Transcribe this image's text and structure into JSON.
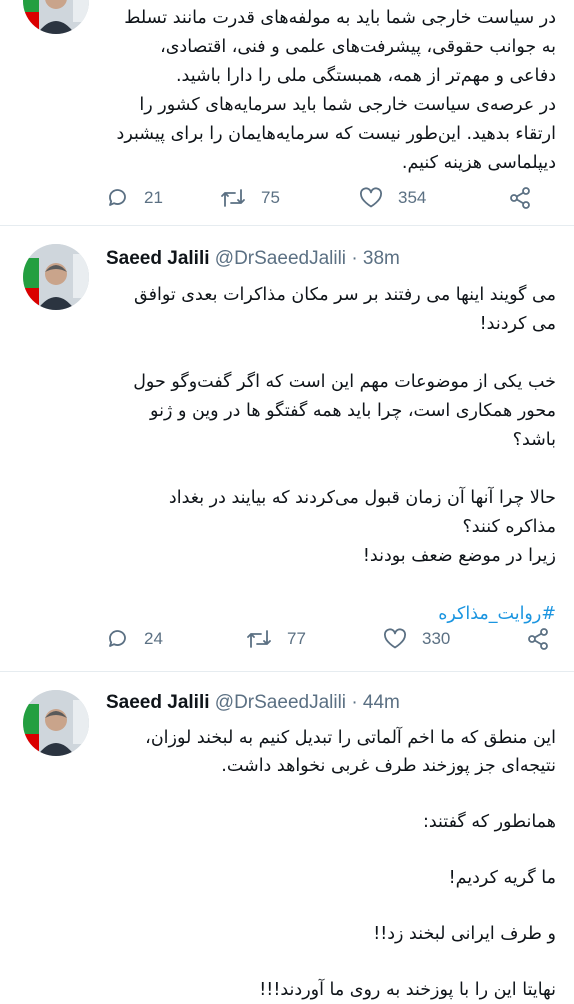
{
  "tweets": [
    {
      "lines": [
        "در سیاست خارجی شما باید به مولفه‌های قدرت مانند تسلط",
        "به جوانب حقوقی، پیشرفت‌های علمی و فنی، اقتصادی،",
        "دفاعی و مهم‌تر از همه، همبستگی ملی را دارا باشید.",
        "در عرصه‌ی سیاست خارجی شما باید سرمایه‌های کشور را",
        "ارتقاء بدهید. این‌طور نیست که سرمایه‌هایمان را برای پیشبرد",
        "دیپلماسی هزینه کنیم."
      ],
      "stats": {
        "replies": "21",
        "retweets": "75",
        "likes": "354"
      }
    },
    {
      "author": {
        "name": "Saeed Jalili",
        "handle": "@DrSaeedJalili",
        "time": "38m"
      },
      "lines": [
        "می گویند اینها می رفتند بر سر مکان مذاکرات بعدی توافق",
        "می کردند!",
        "",
        "خب یکی از موضوعات مهم این است که اگر گفت‌وگو حول",
        "محور همکاری است، چرا باید همه گفتگو ها در وین و ژنو",
        "باشد؟",
        "",
        "حالا چرا آنها آن زمان قبول می‌کردند که بیایند در بغداد",
        "مذاکره کنند؟",
        "زیرا در موضع ضعف بودند!",
        ""
      ],
      "hashtag": "#روایت_مذاکره",
      "stats": {
        "replies": "24",
        "retweets": "77",
        "likes": "330"
      }
    },
    {
      "author": {
        "name": "Saeed Jalili",
        "handle": "@DrSaeedJalili",
        "time": "44m"
      },
      "lines": [
        "این منطق که ما اخم آلماتی را تبدیل کنیم به لبخند لوزان،",
        "نتیجه‌ای جز پوزخند طرف غربی نخواهد داشت.",
        "",
        "همانطور که گفتند:",
        "",
        "ما گریه کردیم!",
        "",
        "و طرف ایرانی لبخند زد!!",
        "",
        "نهایتا این را با پوزخند به روی ما آوردند!!!"
      ]
    }
  ]
}
